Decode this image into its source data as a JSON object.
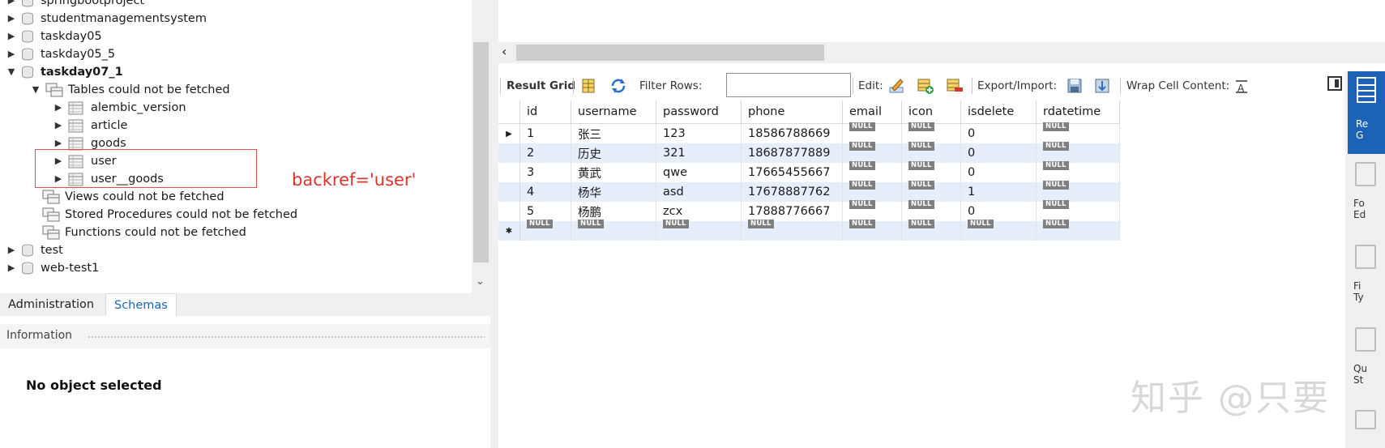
{
  "navigator": {
    "tree": [
      {
        "label": "springbootproject",
        "type": "schema",
        "expanded": false
      },
      {
        "label": "studentmanagementsystem",
        "type": "schema",
        "expanded": false
      },
      {
        "label": "taskday05",
        "type": "schema",
        "expanded": false
      },
      {
        "label": "taskday05_5",
        "type": "schema",
        "expanded": false
      },
      {
        "label": "taskday07_1",
        "type": "schema",
        "expanded": true
      },
      {
        "label": "Tables could not be fetched",
        "type": "group",
        "expanded": true
      },
      {
        "label": "alembic_version",
        "type": "table"
      },
      {
        "label": "article",
        "type": "table"
      },
      {
        "label": "goods",
        "type": "table"
      },
      {
        "label": "user",
        "type": "table"
      },
      {
        "label": "user__goods",
        "type": "table"
      },
      {
        "label": "Views could not be fetched",
        "type": "group"
      },
      {
        "label": "Stored Procedures could not be fetched",
        "type": "group"
      },
      {
        "label": "Functions could not be fetched",
        "type": "group"
      },
      {
        "label": "test",
        "type": "schema",
        "expanded": false
      },
      {
        "label": "web-test1",
        "type": "schema",
        "expanded": false
      }
    ],
    "tabs": {
      "administration": "Administration",
      "schemas": "Schemas"
    },
    "information_label": "Information",
    "no_object": "No object selected"
  },
  "annotation": {
    "text": "backref='user'"
  },
  "toolbar": {
    "result_grid": "Result Grid",
    "filter_rows": "Filter Rows:",
    "filter_value": "",
    "edit": "Edit:",
    "export_import": "Export/Import:",
    "wrap_cell": "Wrap Cell Content:"
  },
  "grid": {
    "columns": [
      "id",
      "username",
      "password",
      "phone",
      "email",
      "icon",
      "isdelete",
      "rdatetime"
    ],
    "rows": [
      [
        "1",
        "张三",
        "123",
        "18586788669",
        "NULL",
        "NULL",
        "0",
        "NULL"
      ],
      [
        "2",
        "历史",
        "321",
        "18687877889",
        "NULL",
        "NULL",
        "0",
        "NULL"
      ],
      [
        "3",
        "黄武",
        "qwe",
        "17665455667",
        "NULL",
        "NULL",
        "0",
        "NULL"
      ],
      [
        "4",
        "杨华",
        "asd",
        "17678887762",
        "NULL",
        "NULL",
        "1",
        "NULL"
      ],
      [
        "5",
        "杨鹏",
        "zcx",
        "17888776667",
        "NULL",
        "NULL",
        "0",
        "NULL"
      ]
    ],
    "new_row": [
      "NULL",
      "NULL",
      "NULL",
      "NULL",
      "NULL",
      "NULL",
      "NULL",
      "NULL"
    ]
  },
  "side_panel": {
    "items": [
      {
        "label": "Re\nG",
        "icon": "result-grid-icon"
      },
      {
        "label": "Fo\nEd",
        "icon": "form-editor-icon"
      },
      {
        "label": "Fi\nTy",
        "icon": "field-types-icon"
      },
      {
        "label": "Qu\nSt",
        "icon": "query-stats-icon"
      }
    ]
  },
  "watermark": "知乎 @只要"
}
